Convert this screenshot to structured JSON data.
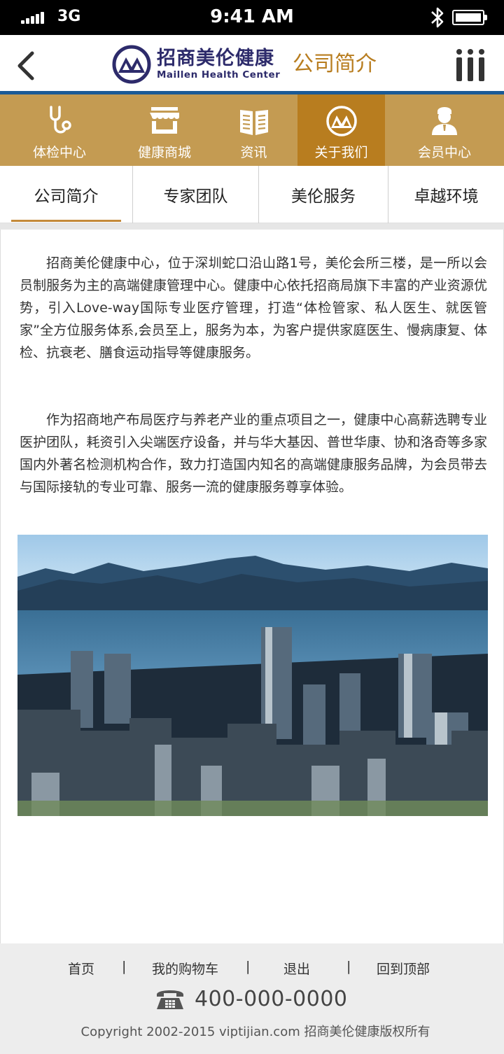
{
  "status_bar": {
    "network": "3G",
    "time": "9:41 AM",
    "signal_icon": "signal-icon",
    "bluetooth_icon": "bluetooth-icon",
    "battery_icon": "battery-icon"
  },
  "header": {
    "back_icon": "chevron-left-icon",
    "logo_cn": "招商美伦健康",
    "logo_en": "Maillen Health Center",
    "page_title": "公司简介",
    "menu_icon": "menu-icon"
  },
  "colors": {
    "nav_bg": "#c49b52",
    "nav_active": "#b87d1f",
    "header_rule": "#1b5a96",
    "title": "#b87d1f",
    "brand": "#2d2b6b"
  },
  "main_nav": [
    {
      "label": "体检中心",
      "icon": "stethoscope-icon",
      "active": false
    },
    {
      "label": "健康商城",
      "icon": "shop-icon",
      "active": false
    },
    {
      "label": "资讯",
      "icon": "book-icon",
      "active": false
    },
    {
      "label": "关于我们",
      "icon": "company-logo-icon",
      "active": true
    },
    {
      "label": "会员中心",
      "icon": "member-icon",
      "active": false
    }
  ],
  "sub_tabs": [
    {
      "label": "公司简介",
      "active": true
    },
    {
      "label": "专家团队",
      "active": false
    },
    {
      "label": "美伦服务",
      "active": false
    },
    {
      "label": "卓越环境",
      "active": false
    }
  ],
  "content": {
    "paragraphs": [
      "招商美伦健康中心，位于深圳蛇口沿山路1号，美伦会所三楼，是一所以会员制服务为主的高端健康管理中心。健康中心依托招商局旗下丰富的产业资源优势，引入Love-way国际专业医疗管理，打造“体检管家、私人医生、就医管家”全方位服务体系,会员至上，服务为本，为客户提供家庭医生、慢病康复、体检、抗衰老、膳食运动指导等健康服务。",
      "作为招商地产布局医疗与养老产业的重点项目之一，健康中心高薪选聘专业医护团队，耗资引入尖端医疗设备，并与华大基因、普世华康、协和洛奇等多家国内外著名检测机构合作，致力打造国内知名的高端健康服务品牌，为会员带去与国际接轨的专业可靠、服务一流的健康服务尊享体验。"
    ]
  },
  "footer": {
    "links": [
      "首页",
      "我的购物车",
      "退出",
      "回到顶部"
    ],
    "separator": "|",
    "phone_icon": "telephone-icon",
    "phone": "400-000-0000",
    "copyright": "Copyright 2002-2015 viptijian.com  招商美伦健康版权所有"
  }
}
